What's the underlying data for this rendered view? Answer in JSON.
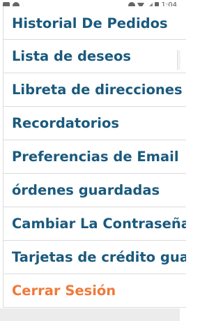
{
  "status_bar": {
    "time": "1:04"
  },
  "menu": {
    "items": [
      {
        "label": "Historial De Pedidos"
      },
      {
        "label": "Lista de deseos"
      },
      {
        "label": "Libreta de direcciones"
      },
      {
        "label": "Recordatorios"
      },
      {
        "label": "Preferencias de Email"
      },
      {
        "label": "órdenes guardadas"
      },
      {
        "label": "Cambiar La Contraseña"
      },
      {
        "label": "Tarjetas de crédito guar"
      },
      {
        "label": "Cerrar Sesión"
      }
    ]
  },
  "colors": {
    "link": "#1a5a7e",
    "logout": "#f07a3a",
    "divider": "#dcdcdc"
  }
}
